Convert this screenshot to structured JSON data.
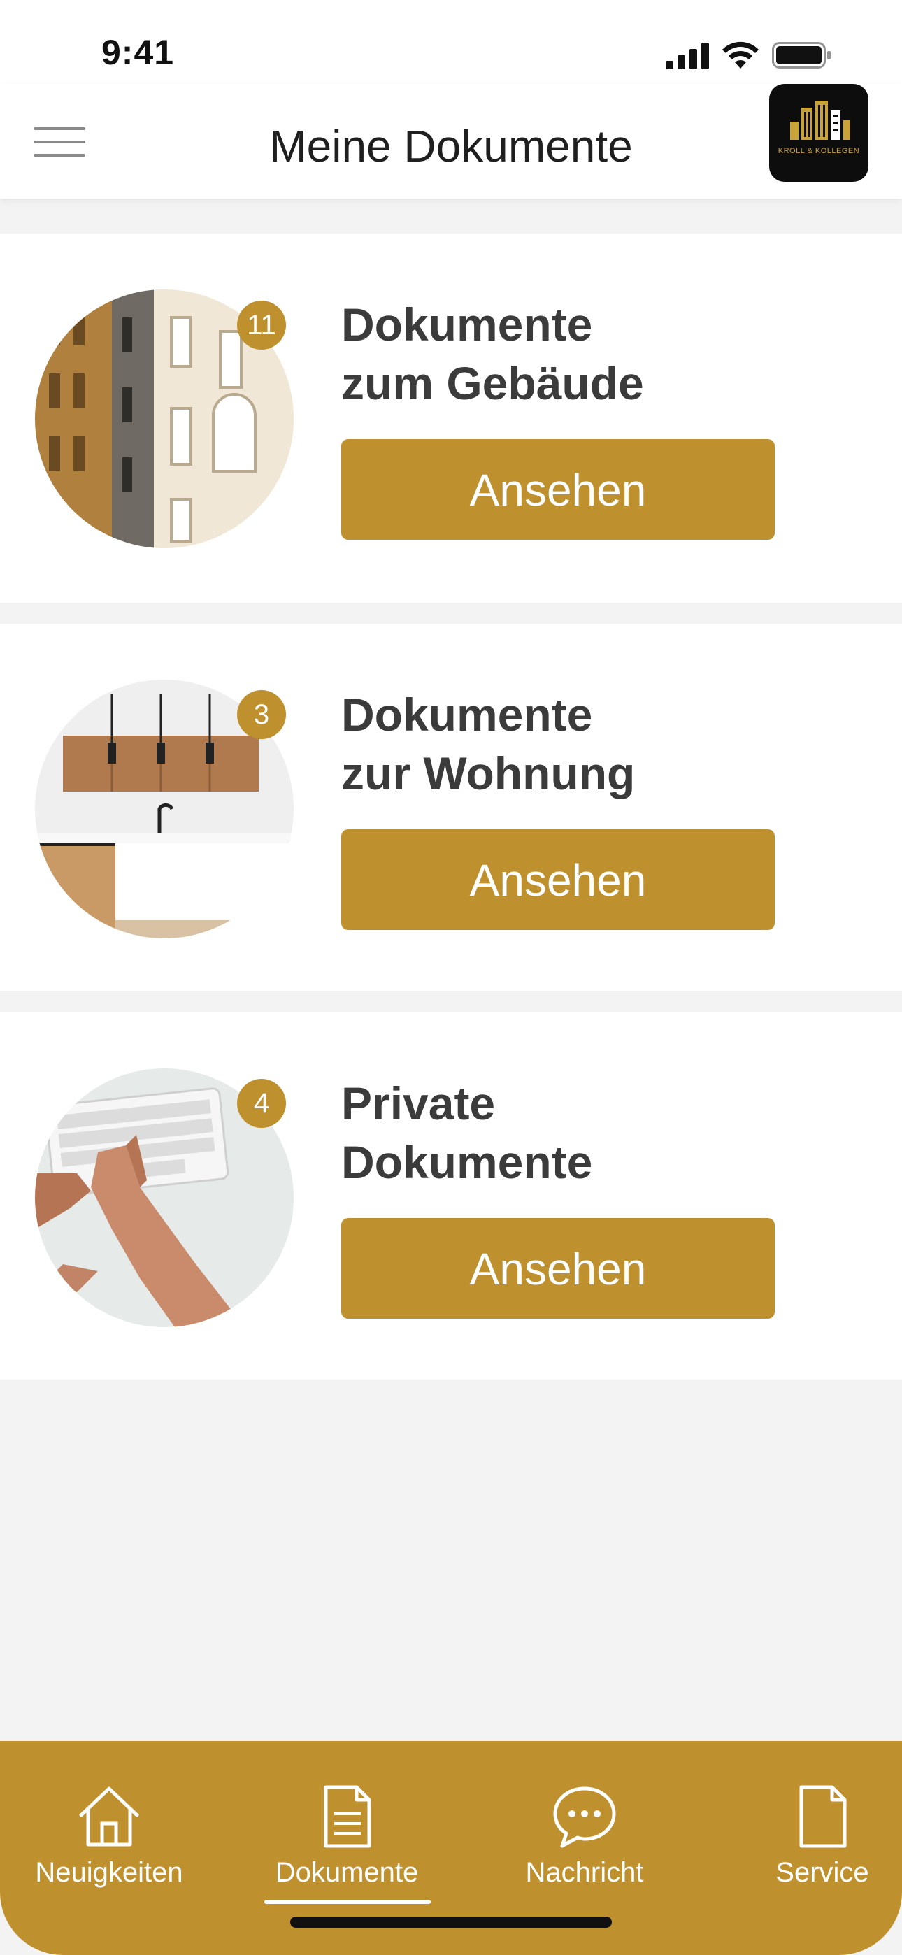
{
  "status_bar": {
    "time": "9:41"
  },
  "header": {
    "title": "Meine Dokumente",
    "logo_text": "KROLL & KOLLEGEN"
  },
  "cards": [
    {
      "badge": "11",
      "title_line1": "Dokumente",
      "title_line2": "zum Gebäude",
      "button_label": "Ansehen"
    },
    {
      "badge": "3",
      "title_line1": "Dokumente",
      "title_line2": "zur Wohnung",
      "button_label": "Ansehen"
    },
    {
      "badge": "4",
      "title_line1": "Private",
      "title_line2": "Dokumente",
      "button_label": "Ansehen"
    }
  ],
  "tab_bar": {
    "tabs": [
      {
        "label": "Neuigkeiten",
        "icon": "home-icon"
      },
      {
        "label": "Dokumente",
        "icon": "document-icon",
        "active": true
      },
      {
        "label": "Nachricht",
        "icon": "chat-bubble-icon"
      },
      {
        "label": "Service",
        "icon": "page-icon"
      }
    ]
  },
  "colors": {
    "accent": "#bf902e",
    "background": "#f3f3f3",
    "card": "#ffffff",
    "text": "#3b3b3b"
  }
}
